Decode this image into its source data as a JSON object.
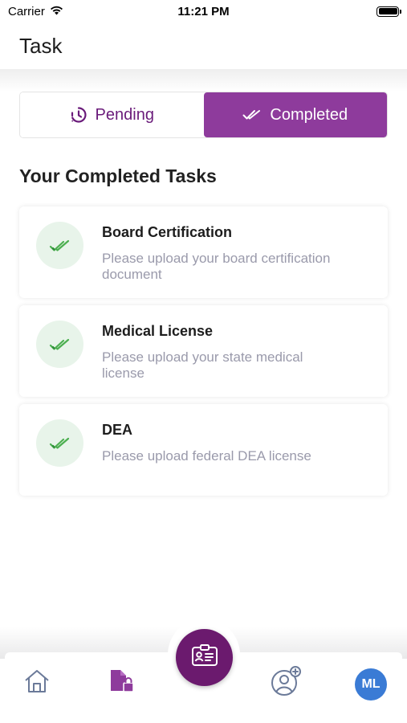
{
  "status_bar": {
    "carrier": "Carrier",
    "time": "11:21 PM"
  },
  "header": {
    "title": "Task"
  },
  "tabs": [
    {
      "label": "Pending",
      "icon": "clock-icon",
      "active": false
    },
    {
      "label": "Completed",
      "icon": "double-check-icon",
      "active": true
    }
  ],
  "section": {
    "title": "Your Completed Tasks"
  },
  "tasks": [
    {
      "title": "Board Certification",
      "description": "Please upload your board certification document",
      "status_icon": "double-check-icon"
    },
    {
      "title": "Medical License",
      "description": "Please upload your state medical license",
      "status_icon": "double-check-icon"
    },
    {
      "title": "DEA",
      "description": "Please upload federal DEA license",
      "status_icon": "double-check-icon"
    }
  ],
  "bottom_nav": {
    "items": [
      "home-icon",
      "document-lock-icon",
      "id-card-icon",
      "add-user-icon"
    ],
    "avatar_initials": "ML"
  },
  "colors": {
    "accent": "#8e3b9c",
    "accent_dark": "#6b1a6e",
    "check_green": "#4caf50",
    "check_bg": "#e8f4ea",
    "avatar": "#3a7bd5"
  }
}
